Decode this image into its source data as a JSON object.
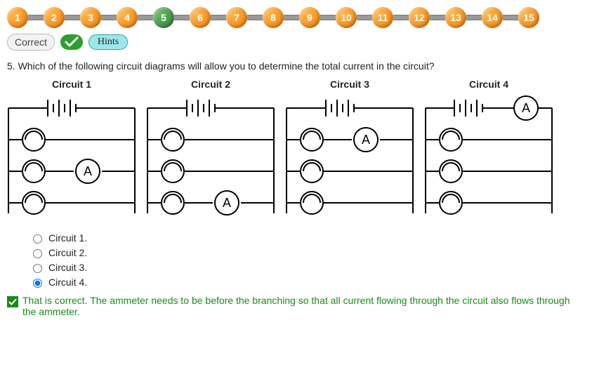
{
  "nav": {
    "total": 15,
    "current": 5,
    "items": [
      {
        "label": "1"
      },
      {
        "label": "2"
      },
      {
        "label": "3"
      },
      {
        "label": "4"
      },
      {
        "label": "5"
      },
      {
        "label": "6"
      },
      {
        "label": "7"
      },
      {
        "label": "8"
      },
      {
        "label": "9"
      },
      {
        "label": "10"
      },
      {
        "label": "11"
      },
      {
        "label": "12"
      },
      {
        "label": "13"
      },
      {
        "label": "14"
      },
      {
        "label": "15"
      }
    ]
  },
  "pills": {
    "correct_label": "Correct",
    "hints_label": "Hints"
  },
  "question": {
    "number": "5.",
    "text": "Which of the following circuit diagrams will allow you to determine the total current in the circuit?"
  },
  "circuits": [
    {
      "title": "Circuit 1",
      "ammeter_position": "branch_middle",
      "ammeter_label": "A"
    },
    {
      "title": "Circuit 2",
      "ammeter_position": "branch_bottom_right",
      "ammeter_label": "A"
    },
    {
      "title": "Circuit 3",
      "ammeter_position": "branch_top_right",
      "ammeter_label": "A"
    },
    {
      "title": "Circuit 4",
      "ammeter_position": "main_top",
      "ammeter_label": "A"
    }
  ],
  "options": [
    {
      "label": "Circuit 1.",
      "selected": false
    },
    {
      "label": "Circuit 2.",
      "selected": false
    },
    {
      "label": "Circuit 3.",
      "selected": false
    },
    {
      "label": "Circuit 4.",
      "selected": true
    }
  ],
  "feedback": {
    "text": "That is correct. The ammeter needs to be before the branching so that all current flowing through the circuit also flows through the ammeter."
  }
}
